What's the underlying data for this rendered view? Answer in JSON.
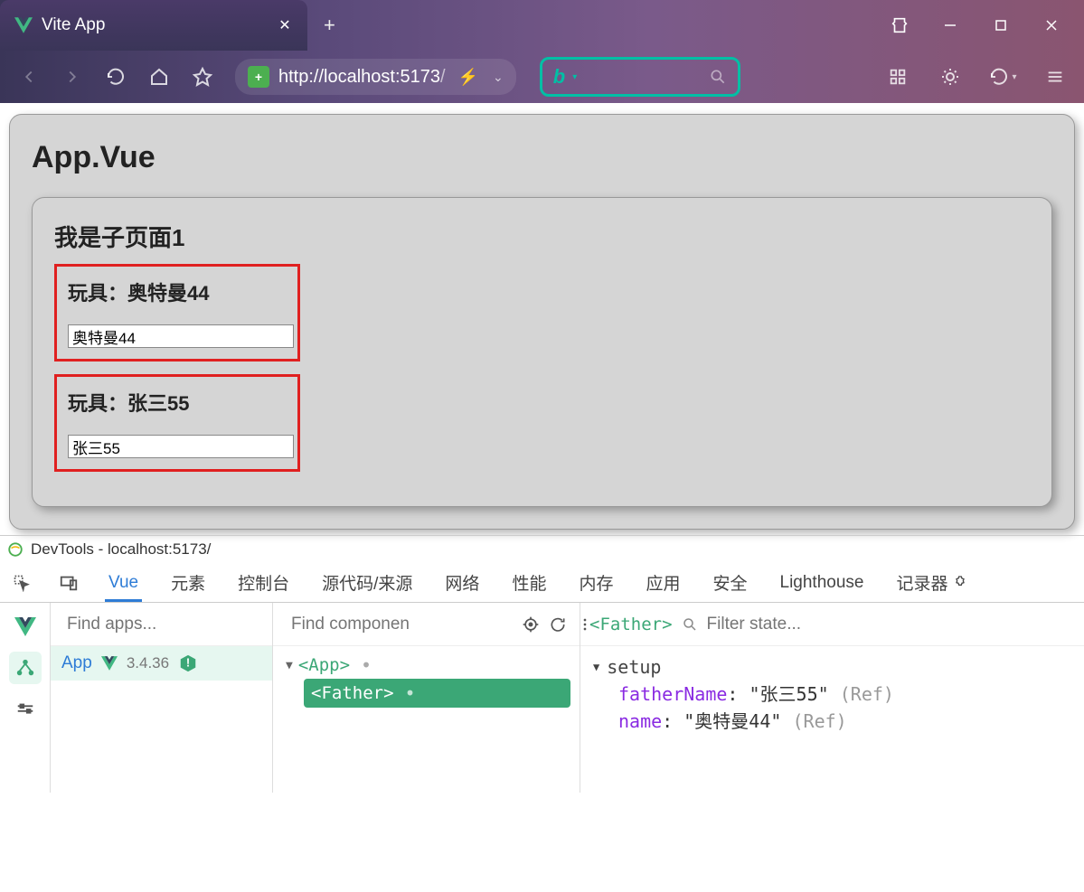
{
  "titlebar": {
    "tab_title": "Vite App",
    "new_tab": "+"
  },
  "navbar": {
    "url_host": "http://localhost:5173",
    "url_path": "/"
  },
  "page": {
    "app_title": "App.Vue",
    "child_title": "我是子页面1",
    "toy1_label": "玩具：奥特曼44",
    "toy1_value": "奥特曼44",
    "toy2_label": "玩具：张三55",
    "toy2_value": "张三55"
  },
  "devtools": {
    "title": "DevTools - localhost:5173/",
    "tabs": [
      "Vue",
      "元素",
      "控制台",
      "源代码/来源",
      "网络",
      "性能",
      "内存",
      "应用",
      "安全",
      "Lighthouse",
      "记录器"
    ],
    "active_tab": "Vue",
    "apps_placeholder": "Find apps...",
    "comp_placeholder": "Find componen",
    "state_placeholder": "Filter state...",
    "app_name": "App",
    "vue_version": "3.4.36",
    "tree_root": "<App>",
    "tree_child": "<Father>",
    "selected_component": "<Father>",
    "setup_label": "setup",
    "state": [
      {
        "key": "fatherName",
        "value": "\"张三55\"",
        "ref": "(Ref)"
      },
      {
        "key": "name",
        "value": "\"奥特曼44\"",
        "ref": "(Ref)"
      }
    ]
  }
}
